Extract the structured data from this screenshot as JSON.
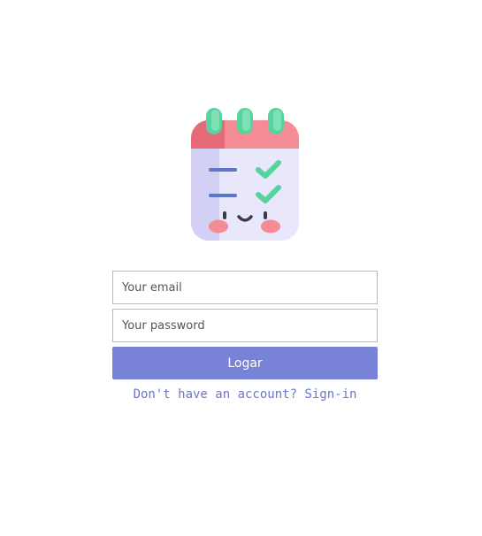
{
  "logo": {
    "icon": "calendar-checklist-icon",
    "colors": {
      "red": "#f48b95",
      "green": "#57d39e",
      "body": "#e9e7fb",
      "accent": "#5b78c8"
    }
  },
  "form": {
    "email": {
      "placeholder": "Your email",
      "value": ""
    },
    "password": {
      "placeholder": "Your password",
      "value": ""
    },
    "submit_label": "Logar",
    "signup_link": "Don't have an account? Sign-in"
  },
  "colors": {
    "button": "#7882d6",
    "link": "#6b76cf"
  }
}
